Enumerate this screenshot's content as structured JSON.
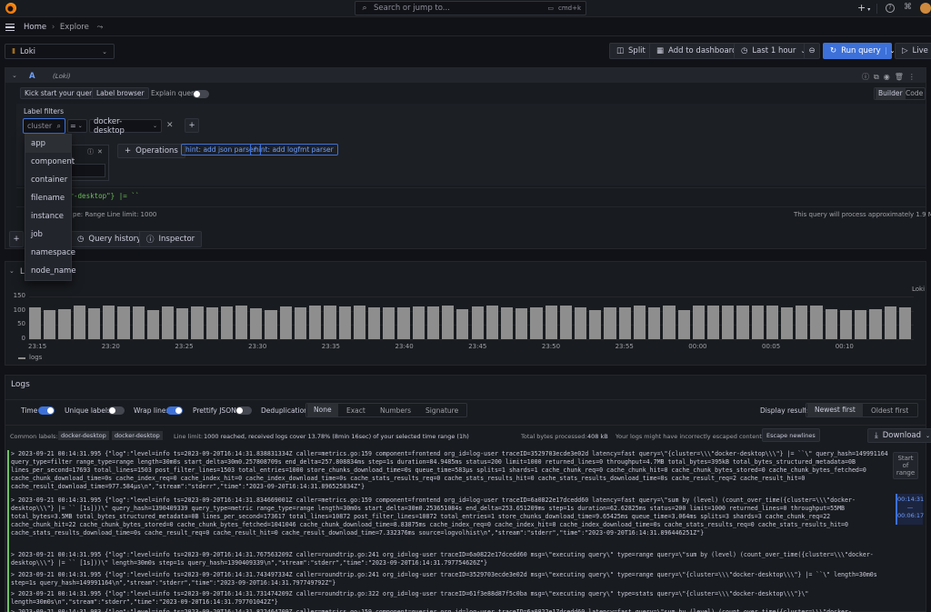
{
  "topbar": {
    "search_placeholder": "Search or jump to...",
    "shortcut": "cmd+k",
    "plus_label": "+"
  },
  "breadcrumb": {
    "home": "Home",
    "separator": "›",
    "current": "Explore"
  },
  "toolbar": {
    "datasource": "Loki",
    "split": "Split",
    "add_to_dashboard": "Add to dashboard",
    "time_range": "Last 1 hour",
    "run_query": "Run query",
    "live": "Live"
  },
  "query": {
    "ref": "A",
    "datasource_tag": "(Loki)",
    "kick_start": "Kick start your query",
    "label_browser": "Label browser",
    "explain": "Explain query",
    "builder_tab": "Builder",
    "code_tab": "Code",
    "label_filters_title": "Label filters",
    "label_select_value": "cluster",
    "operator": "=",
    "label_value": "docker-desktop",
    "operations_button": "Operations",
    "hint_json": "hint: add json parser",
    "hint_logfmt": "hint: add logfmt parser",
    "raw_query_tail": "er-desktop\"} |= ``",
    "options_text": "pe: Range    Line limit: 1000",
    "processing_note": "This query will process approximately 1.9 MiB.",
    "query_history": "Query history",
    "inspector": "Inspector",
    "dropdown_options": [
      "app",
      "component",
      "container",
      "filename",
      "instance",
      "job",
      "namespace",
      "node_name"
    ]
  },
  "chart_data": {
    "type": "bar",
    "title": "Lo",
    "series_label": "Loki",
    "legend": "logs",
    "yticks": [
      "150",
      "100",
      "50",
      "0"
    ],
    "xticks": [
      "23:15",
      "23:20",
      "23:25",
      "23:30",
      "23:35",
      "23:40",
      "23:45",
      "23:50",
      "23:55",
      "00:00",
      "00:05",
      "00:10"
    ],
    "ylim": [
      0,
      150
    ],
    "values": [
      112,
      108,
      103,
      118,
      104,
      111,
      117,
      100,
      108,
      103,
      118,
      116,
      114,
      106,
      115,
      110,
      103,
      113,
      116,
      118,
      110,
      105,
      114,
      118,
      113,
      104,
      115,
      104,
      118,
      116,
      108,
      112,
      103,
      114,
      116,
      108,
      113,
      104,
      117,
      112,
      118,
      113,
      116,
      105,
      117,
      114,
      112,
      105,
      112,
      117,
      112,
      117,
      116,
      104,
      114,
      104,
      118,
      100,
      104,
      111,
      115,
      103,
      118,
      116,
      113,
      104,
      110,
      116,
      112,
      103,
      117,
      117,
      118,
      103,
      112,
      112,
      103,
      117,
      111,
      119,
      111,
      101,
      117,
      108,
      112,
      117,
      117,
      112,
      103,
      104,
      119,
      112,
      117,
      103,
      118,
      103,
      119,
      117,
      118,
      117,
      119,
      116,
      112,
      109,
      118,
      114,
      118,
      101,
      105,
      111,
      103,
      112,
      103,
      118,
      104,
      110,
      116,
      108,
      112,
      117
    ]
  },
  "logs_panel": {
    "title": "Logs",
    "time": "Time",
    "unique_labels": "Unique labels",
    "wrap_lines": "Wrap lines",
    "prettify_json": "Prettify JSON",
    "deduplication": "Deduplication",
    "dedup_options": [
      "None",
      "Exact",
      "Numbers",
      "Signature"
    ],
    "display_results": "Display results",
    "newest_first": "Newest first",
    "oldest_first": "Oldest first",
    "common_labels_label": "Common labels:",
    "common_labels": [
      "docker-desktop",
      "docker-desktop"
    ],
    "line_limit": "Line limit:",
    "line_limit_text": "1000 reached, received logs cover 13.78% (8min 16sec) of your selected time range (1h)",
    "bytes_processed_label": "Total bytes processed:",
    "bytes_processed": "408 kB",
    "escape_warning": "Your logs might have incorrectly escaped content:",
    "escape_button": "Escape newlines",
    "download": "Download",
    "start_of_range": "Start of range",
    "nav_top": "00:14:31",
    "nav_dash": "—",
    "nav_bottom": "00:06:17"
  },
  "log_lines": [
    "> 2023-09-21 00:14:31.995 {\"log\":\"level=info ts=2023-09-20T16:14:31.838831334Z caller=metrics.go:159 component=frontend org_id=log-user traceID=3529703ecde3e02d latency=fast query=\\\"{cluster=\\\\\\\"docker-desktop\\\\\\\"} |= ``\\\" query_hash=149991164 query_type=filter range_type=range length=30m0s start_delta=30m0.257808709s end_delta=257.808834ms step=1s duration=84.9485ms status=200 limit=1000 returned_lines=0 throughput=4.7MB total_bytes=395kB total_bytes_structured_metadata=0B lines_per_second=17693 total_lines=1503 post_filter_lines=1503 total_entries=1000 store_chunks_download_time=0s queue_time=583µs splits=1 shards=1 cache_chunk_req=0 cache_chunk_hit=0 cache_chunk_bytes_stored=0 cache_chunk_bytes_fetched=0 cache_chunk_download_time=0s cache_index_req=0 cache_index_hit=0 cache_index_download_time=0s cache_stats_results_req=0 cache_stats_results_hit=0 cache_stats_results_download_time=0s cache_result_req=2 cache_result_hit=0 cache_result_download_time=977.584µs\\n\",\"stream\":\"stderr\",\"time\":\"2023-09-20T16:14:31.896525834Z\"}",
    "> 2023-09-21 00:14:31.995 {\"log\":\"level=info ts=2023-09-20T16:14:31.834669001Z caller=metrics.go:159 component=frontend org_id=log-user traceID=6a0822e17dcedd60 latency=fast query=\\\"sum by (level) (count_over_time({cluster=\\\\\\\"docker-desktop\\\\\\\"} |= `` [1s]))\\\" query_hash=1390409339 query_type=metric range_type=range length=30m0s start_delta=30m0.253651084s end_delta=253.651209ms step=1s duration=62.62825ms status=200 limit=1000 returned_lines=0 throughput=55MB total_bytes=3.5MB total_bytes_structured_metadata=0B lines_per_second=173617 total_lines=10872 post_filter_lines=10872 total_entries=1 store_chunks_download_time=9.65425ms queue_time=3.064ms splits=3 shards=3 cache_chunk_req=22 cache_chunk_hit=22 cache_chunk_bytes_stored=0 cache_chunk_bytes_fetched=1041046 cache_chunk_download_time=8.83875ms cache_index_req=0 cache_index_hit=0 cache_index_download_time=0s cache_stats_results_req=0 cache_stats_results_hit=0 cache_stats_results_download_time=0s cache_result_req=0 cache_result_hit=0 cache_result_download_time=7.332376ms source=logvolhist\\n\",\"stream\":\"stderr\",\"time\":\"2023-09-20T16:14:31.896446251Z\"}",
    "> 2023-09-21 00:14:31.995 {\"log\":\"level=info ts=2023-09-20T16:14:31.767563209Z caller=roundtrip.go:241 org_id=log-user traceID=6a0822e17dcedd60 msg=\\\"executing query\\\" type=range query=\\\"sum by (level) (count_over_time({cluster=\\\\\\\"docker-desktop\\\\\\\"} |= `` [1s]))\\\" length=30m0s step=1s query_hash=1390409339\\n\",\"stream\":\"stderr\",\"time\":\"2023-09-20T16:14:31.797754626Z\"}",
    "> 2023-09-21 00:14:31.995 {\"log\":\"level=info ts=2023-09-20T16:14:31.743497334Z caller=roundtrip.go:241 org_id=log-user traceID=3529703ecde3e02d msg=\\\"executing query\\\" type=range query=\\\"{cluster=\\\\\\\"docker-desktop\\\\\\\"} |= ``\\\" length=30m0s step=1s query_hash=149991164\\n\",\"stream\":\"stderr\",\"time\":\"2023-09-20T16:14:31.797749792Z\"}",
    "> 2023-09-21 00:14:31.995 {\"log\":\"level=info ts=2023-09-20T16:14:31.731474209Z caller=roundtrip.go:322 org_id=log-user traceID=61f3e88d87f5c0ba msg=\\\"executing query\\\" type=stats query=\\\"{cluster=\\\\\\\"docker-desktop\\\\\\\"}\\\" length=30m0s\\n\",\"stream\":\"stderr\",\"time\":\"2023-09-20T16:14:31.797701042Z\"}",
    "> 2023-09-21 00:14:31.983 {\"log\":\"level=info ts=2023-09-20T16:14:31.822464709Z caller=metrics.go:159 component=querier org_id=log-user traceID=6a0822e17dcedd60 latency=fast query=\\\"sum by (level) (count_over_time({cluster=\\\\\\\"docker-desktop\\\\\\\"} |= `` [1s]))\\\""
  ]
}
